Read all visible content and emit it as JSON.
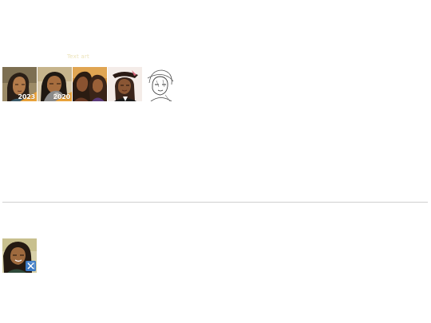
{
  "header": {
    "tagline": "Text art"
  },
  "gallery": {
    "items": [
      {
        "id": "thumb-1",
        "badge": "2023",
        "icon": "portrait-thumbnail"
      },
      {
        "id": "thumb-2",
        "badge": "2020",
        "icon": "portrait-thumbnail"
      },
      {
        "id": "thumb-3",
        "badge": "",
        "icon": "couple-portrait-thumbnail"
      },
      {
        "id": "thumb-4",
        "badge": "",
        "icon": "pirate-portrait-thumbnail"
      },
      {
        "id": "thumb-5",
        "badge": "",
        "icon": "sketch-portrait-thumbnail"
      }
    ]
  },
  "profile": {
    "avatar_icon": "user-avatar",
    "badge_icon": "x-badge-icon"
  },
  "colors": {
    "tagline": "#ece3b8",
    "divider": "#cfcfcf",
    "badge_orange": "#e8a23a",
    "badge_blue": "#3a79c4"
  }
}
